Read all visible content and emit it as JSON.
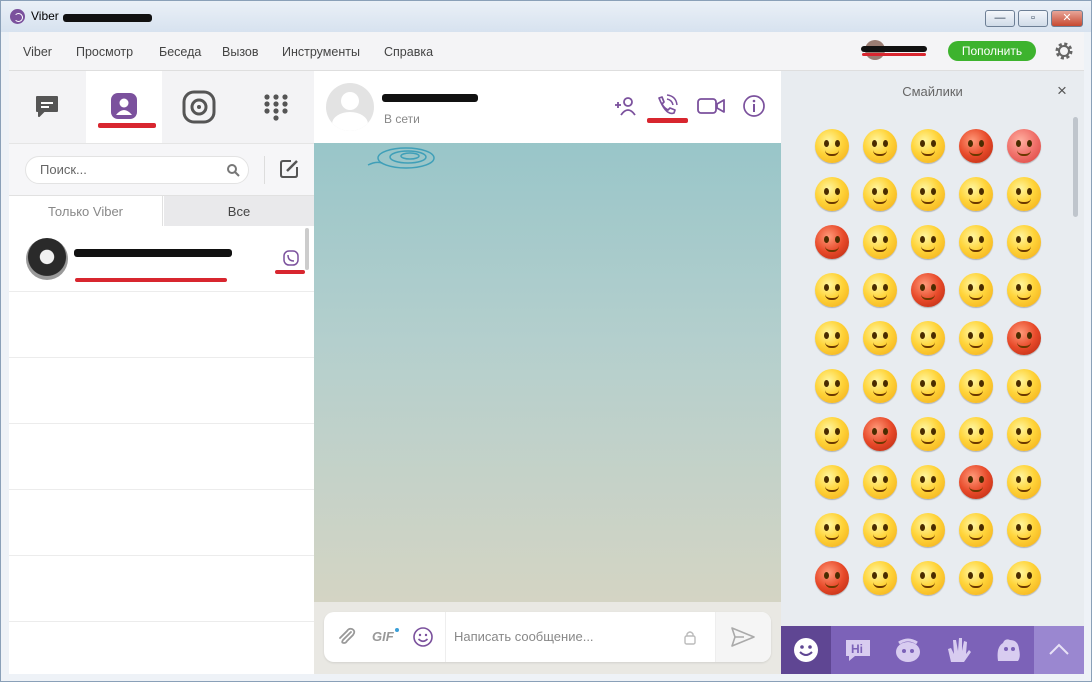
{
  "app": {
    "window_title": "Viber",
    "title_redacted": true
  },
  "window_buttons": {
    "minimize": "—",
    "maximize": "▫",
    "close": "✕"
  },
  "menu": {
    "items": [
      "Viber",
      "Просмотр",
      "Беседа",
      "Вызов",
      "Инструменты",
      "Справка"
    ],
    "topup_label": "Пополнить"
  },
  "sidebar": {
    "tabs": [
      "chats-icon",
      "contacts-icon",
      "public-accounts-icon",
      "dialpad-icon"
    ],
    "active_tab": "contacts-icon",
    "search_placeholder": "Поиск...",
    "filters": [
      "Только Viber",
      "Все"
    ],
    "active_filter": "Все",
    "contacts": [
      {
        "name_redacted": true,
        "has_viber": true
      }
    ]
  },
  "chat": {
    "contact_name_redacted": true,
    "contact_status": "В сети",
    "gif_label": "GIF",
    "message_placeholder": "Написать сообщение..."
  },
  "emoji_panel": {
    "title": "Смайлики",
    "close": "×",
    "categories": [
      "smiley-icon",
      "hi-sticker-icon",
      "character-icon",
      "hand-icon",
      "creature-icon",
      "up-arrow-icon"
    ],
    "active_category": "smiley-icon"
  },
  "colors": {
    "viber_purple": "#7b519d",
    "panel_purple": "#7c62b8",
    "topup_green": "#3db32e",
    "annotation_red": "#d8262f"
  }
}
